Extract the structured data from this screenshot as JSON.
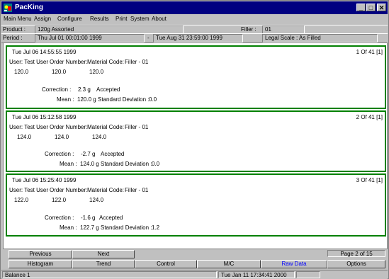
{
  "window": {
    "title": "PacKing",
    "minimize_label": "_",
    "maximize_label": "□",
    "close_label": "✕"
  },
  "menu": {
    "items": [
      "Main Menu",
      "Assign",
      "Configure",
      "Results",
      "Print",
      "System",
      "About"
    ]
  },
  "info": {
    "product_label": "Product :",
    "product_value": "120g Assorted",
    "filler_label": "Filler :",
    "filler_value": "01",
    "period_label": "Period :",
    "period_start": "Thu Jul 01 00:01:00 1999",
    "period_separator": "-",
    "period_end": "Tue Aug 31 23:59:00 1999",
    "legal_scale": "Legal Scale : As Filled"
  },
  "records": [
    {
      "timestamp": "Tue Jul 06 14:55:55 1999",
      "count": "1 Of 41 [1]",
      "user": "User: Test User",
      "order": "Order Number:",
      "material": "Material Code:",
      "filler": "Filler - 01",
      "weights": [
        "120.0",
        "120.0",
        "120.0"
      ],
      "correction_label": "Correction :",
      "correction_value": "2.3 g",
      "status": "Accepted",
      "mean_label": "Mean :",
      "mean_value": "120.0 g",
      "std_label": "Standard Deviation :",
      "std_value": "0.0"
    },
    {
      "timestamp": "Tue Jul 06 15:12:58 1999",
      "count": "2 Of 41 [1]",
      "user": "User: Test User",
      "order": "Order Number:",
      "material": "Material Code:",
      "filler": "Filler - 01",
      "weights": [
        "124.0",
        "124.0",
        "124.0"
      ],
      "correction_label": "Correction :",
      "correction_value": "-2.7 g",
      "status": "Accepted",
      "mean_label": "Mean :",
      "mean_value": "124.0 g",
      "std_label": "Standard Deviation :",
      "std_value": "0.0"
    },
    {
      "timestamp": "Tue Jul 06 15:25:40 1999",
      "count": "3 Of 41 [1]",
      "user": "User: Test User",
      "order": "Order Number:",
      "material": "Material Code:",
      "filler": "Filler - 01",
      "weights": [
        "122.0",
        "122.0",
        "124.0"
      ],
      "correction_label": "Correction :",
      "correction_value": "-1.6 g",
      "status": "Accepted",
      "mean_label": "Mean :",
      "mean_value": "122.7 g",
      "std_label": "Standard Deviation :",
      "std_value": "1.2"
    }
  ],
  "pager": {
    "previous_label": "Previous",
    "next_label": "Next",
    "page_text": "Page 2 of 15"
  },
  "views": {
    "histogram": "Histogram",
    "trend": "Trend",
    "control": "Control",
    "mc": "M/C",
    "raw_data": "Raw Data",
    "options": "Options",
    "active_color": "#0000ff"
  },
  "status": {
    "balance": "Balance 1",
    "datetime": "Tue Jan 11 17:34:41 2000"
  }
}
